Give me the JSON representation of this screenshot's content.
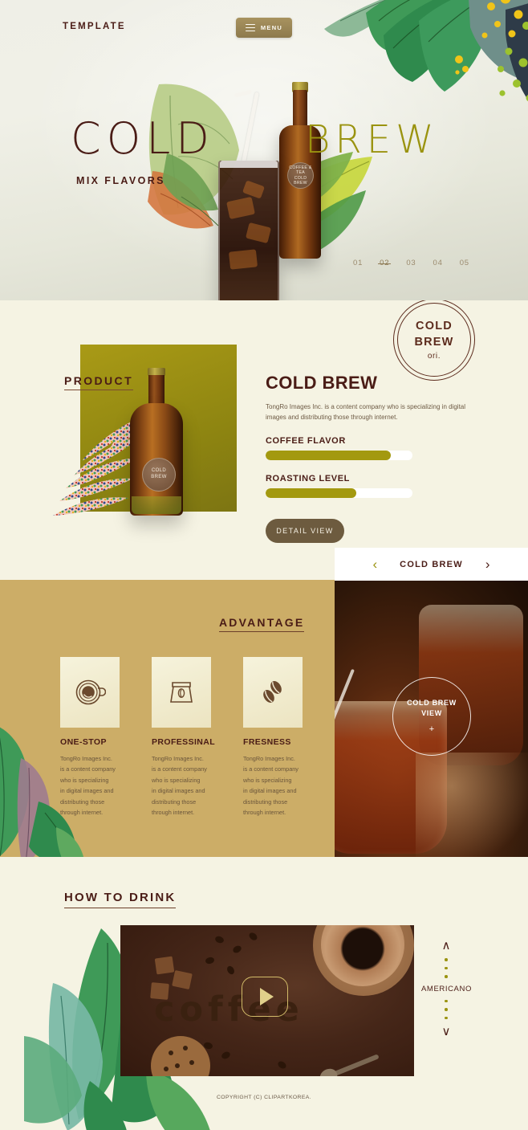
{
  "hero": {
    "logo": "TEMPLATE",
    "menu_label": "MENU",
    "title_part1": "COLD",
    "title_part2": "BREW",
    "subtitle": "MIX FLAVORS",
    "bottle_label_top": "COFFEE & TEA",
    "bottle_label_main1": "COLD",
    "bottle_label_main2": "BREW",
    "pager": [
      {
        "label": "01",
        "active": false
      },
      {
        "label": "02",
        "active": true
      },
      {
        "label": "03",
        "active": false
      },
      {
        "label": "04",
        "active": false
      },
      {
        "label": "05",
        "active": false
      }
    ],
    "colors": {
      "title1": "#4a1c16",
      "title2": "#9a9310",
      "bg_top": "#efefe7",
      "bg_bottom": "#d6d7c9"
    }
  },
  "product": {
    "section_label": "PRODUCT",
    "badge": {
      "line1": "COLD",
      "line2": "BREW",
      "line3": "ori."
    },
    "title": "COLD BREW",
    "description": "TongRo Images Inc. is a content company who is specializing in digital images and distributing those through internet.",
    "bottle_label_main1": "COLD",
    "bottle_label_main2": "BREW",
    "bars": [
      {
        "label": "COFFEE FLAVOR",
        "percent": 85
      },
      {
        "label": "ROASTING LEVEL",
        "percent": 62
      }
    ],
    "detail_button": "DETAIL VIEW",
    "colors": {
      "bg": "#f5f3e3",
      "rect": "#8e8511",
      "bar_fill": "#a3990f",
      "button": "#6d5b3f"
    }
  },
  "cold_brew_nav": {
    "prev_icon": "chevron-left-icon",
    "prev_glyph": "‹",
    "label": "COLD BREW",
    "next_icon": "chevron-right-icon",
    "next_glyph": "›"
  },
  "advantage": {
    "section_label": "ADVANTAGE",
    "cards": [
      {
        "icon": "coffee-cup-icon",
        "title": "ONE-STOP",
        "desc": "TongRo Images Inc.\nis a content company\nwho is specializing\nin digital images and\ndistributing those\nthrough internet."
      },
      {
        "icon": "coffee-bag-icon",
        "title": "PROFESSINAL",
        "desc": "TongRo Images Inc.\nis a content company\nwho is specializing\nin digital images and\ndistributing those\nthrough internet."
      },
      {
        "icon": "coffee-beans-icon",
        "title": "FRESNESS",
        "desc": "TongRo Images Inc.\nis a content company\nwho is specializing\nin digital images and\ndistributing those\nthrough internet."
      }
    ],
    "view_circle": {
      "line1": "COLD BREW",
      "line2": "VIEW",
      "plus": "+"
    },
    "colors": {
      "bg": "#ccad67",
      "icon_box": "#f0ead0"
    }
  },
  "how_to_drink": {
    "section_label": "HOW TO DRINK",
    "video_word": "coffee",
    "play_icon": "play-icon",
    "side_nav": {
      "up_icon": "chevron-up-icon",
      "up_glyph": "∧",
      "label": "AMERICANO",
      "down_icon": "chevron-down-icon",
      "down_glyph": "∨",
      "dots_above": 3,
      "dots_below": 3
    }
  },
  "footer": {
    "copyright": "COPYRIGHT (C) CLIPARTKOREA."
  }
}
